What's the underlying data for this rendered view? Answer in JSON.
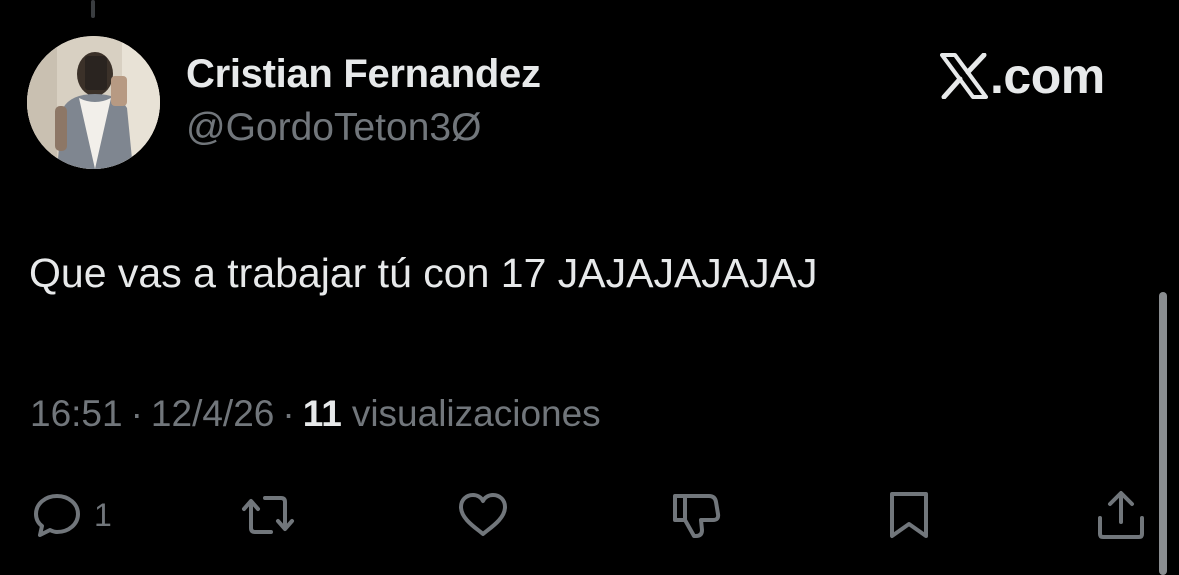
{
  "tweet": {
    "author": {
      "display_name": "Cristian Fernandez",
      "handle": "@GordoTeton3Ø"
    },
    "brand": {
      "suffix": ".com"
    },
    "text": "Que vas a trabajar tú con 17 JAJAJAJAJAJ",
    "meta": {
      "time": "16:51",
      "separator": "·",
      "date": "12/4/26",
      "views_count": "11",
      "views_label": "visualizaciones"
    },
    "actions": {
      "reply_count": "1",
      "icons": [
        "reply-icon",
        "repost-icon",
        "like-icon",
        "dislike-icon",
        "bookmark-icon",
        "share-icon"
      ]
    }
  },
  "colors": {
    "background": "#000000",
    "primary_text": "#e7e9ea",
    "secondary_text": "#71767b"
  }
}
